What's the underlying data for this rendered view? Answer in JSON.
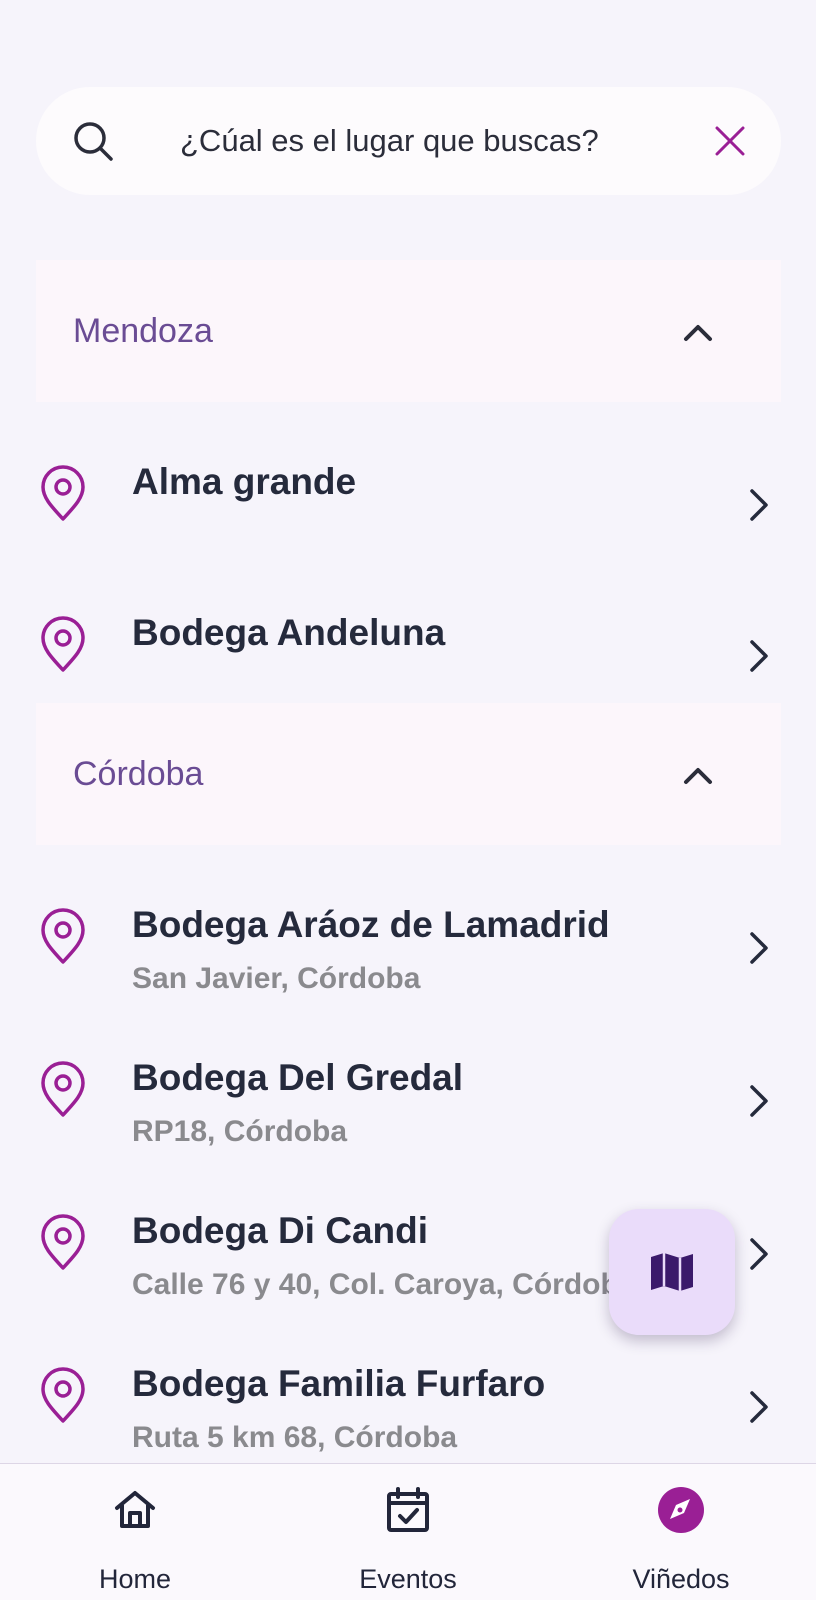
{
  "search": {
    "placeholder": "¿Cúal es el lugar que buscas?"
  },
  "sections": [
    {
      "title": "Mendoza",
      "items": [
        {
          "name": "Alma grande",
          "location": ""
        },
        {
          "name": "Bodega Andeluna",
          "location": ""
        }
      ]
    },
    {
      "title": "Córdoba",
      "items": [
        {
          "name": "Bodega Aráoz de Lamadrid",
          "location": "San Javier, Córdoba"
        },
        {
          "name": "Bodega Del Gredal",
          "location": "RP18, Córdoba"
        },
        {
          "name": "Bodega Di Candi",
          "location": "Calle 76 y 40, Col. Caroya, Córdoba"
        },
        {
          "name": "Bodega Familia Furfaro",
          "location": "Ruta 5 km 68, Córdoba"
        }
      ]
    }
  ],
  "icons": {
    "search": "search-icon",
    "clear": "close-icon",
    "pin": "map-pin-icon",
    "collapse": "chevron-up-icon",
    "row_arrow": "chevron-right-icon",
    "fab": "map-icon",
    "home": "home-icon",
    "events": "calendar-check-icon",
    "vineyards": "compass-icon"
  },
  "fab": {
    "label": ""
  },
  "bottom_nav": [
    {
      "label": "Home",
      "active": false
    },
    {
      "label": "Eventos",
      "active": false
    },
    {
      "label": "Viñedos",
      "active": true
    }
  ],
  "colors": {
    "accent": "#9a1f95",
    "section_title": "#6a4c94",
    "text_primary": "#252a3c",
    "text_secondary": "#8a8a8e",
    "background": "#f6f4fb",
    "fab_background": "#eadcfa",
    "fab_icon": "#3b1a6b"
  }
}
